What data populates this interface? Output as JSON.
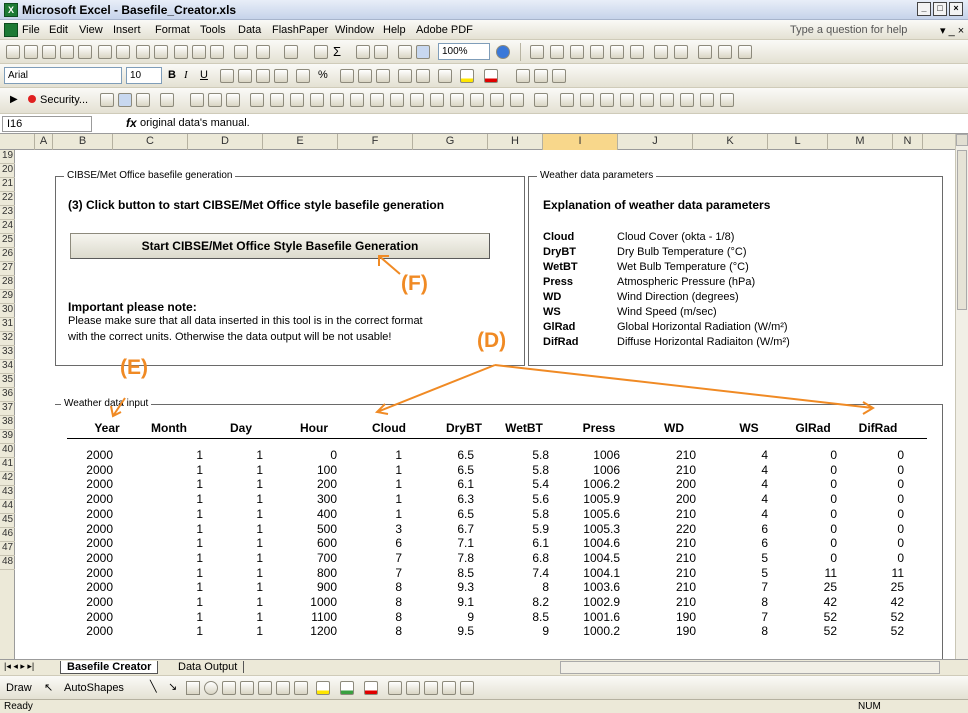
{
  "window": {
    "title": "Microsoft Excel - Basefile_Creator.xls",
    "min": "_",
    "max": "□",
    "close": "×"
  },
  "menu": {
    "items": [
      "File",
      "Edit",
      "View",
      "Insert",
      "Format",
      "Tools",
      "Data",
      "FlashPaper",
      "Window",
      "Help",
      "Adobe PDF"
    ],
    "help_placeholder": "Type a question for help"
  },
  "toolbar": {
    "zoom": "100%",
    "font": "Arial",
    "size": "10",
    "bold": "B",
    "italic": "I",
    "underline": "U",
    "security": "Security...",
    "percent": "%",
    "sigma": "Σ"
  },
  "formula": {
    "namebox": "I16",
    "fx": "fx",
    "content": "original data's manual."
  },
  "columns": [
    "A",
    "B",
    "C",
    "D",
    "E",
    "F",
    "G",
    "H",
    "I",
    "J",
    "K",
    "L",
    "M",
    "N"
  ],
  "rows": [
    "19",
    "20",
    "21",
    "22",
    "23",
    "24",
    "25",
    "26",
    "27",
    "28",
    "29",
    "30",
    "31",
    "32",
    "33",
    "34",
    "35",
    "36",
    "37",
    "38",
    "39",
    "40",
    "41",
    "42",
    "43",
    "44",
    "45",
    "46",
    "47",
    "48"
  ],
  "gen_group": {
    "label": "CIBSE/Met Office basefile generation",
    "step": "(3) Click button to start CIBSE/Met Office style basefile generation",
    "button": "Start CIBSE/Met Office Style Basefile Generation",
    "note_title": "Important please note:",
    "note_line1": "Please make sure that all data inserted in this tool is in the correct format",
    "note_line2": "with the correct units. Otherwise the data output will be not usable!"
  },
  "params_group": {
    "label": "Weather data parameters",
    "heading": "Explanation of weather data parameters",
    "items": [
      {
        "code": "Cloud",
        "desc": "Cloud Cover (okta - 1/8)"
      },
      {
        "code": "DryBT",
        "desc": "Dry Bulb Temperature (°C)"
      },
      {
        "code": "WetBT",
        "desc": "Wet Bulb Temperature (°C)"
      },
      {
        "code": "Press",
        "desc": "Atmospheric Pressure (hPa)"
      },
      {
        "code": "WD",
        "desc": "Wind Direction (degrees)"
      },
      {
        "code": "WS",
        "desc": "Wind Speed (m/sec)"
      },
      {
        "code": "GlRad",
        "desc": "Global Horizontal Radiation (W/m²)"
      },
      {
        "code": "DifRad",
        "desc": "Diffuse Horizontal Radiaiton (W/m²)"
      }
    ]
  },
  "annotations": {
    "D": "(D)",
    "E": "(E)",
    "F": "(F)"
  },
  "input_group": {
    "label": "Weather data input",
    "headers": [
      "Year",
      "Month",
      "Day",
      "Hour",
      "Cloud",
      "DryBT",
      "WetBT",
      "Press",
      "WD",
      "WS",
      "GlRad",
      "DifRad"
    ],
    "rows": [
      [
        "2000",
        "1",
        "1",
        "0",
        "1",
        "6.5",
        "5.8",
        "1006",
        "210",
        "4",
        "0",
        "0"
      ],
      [
        "2000",
        "1",
        "1",
        "100",
        "1",
        "6.5",
        "5.8",
        "1006",
        "210",
        "4",
        "0",
        "0"
      ],
      [
        "2000",
        "1",
        "1",
        "200",
        "1",
        "6.1",
        "5.4",
        "1006.2",
        "200",
        "4",
        "0",
        "0"
      ],
      [
        "2000",
        "1",
        "1",
        "300",
        "1",
        "6.3",
        "5.6",
        "1005.9",
        "200",
        "4",
        "0",
        "0"
      ],
      [
        "2000",
        "1",
        "1",
        "400",
        "1",
        "6.5",
        "5.8",
        "1005.6",
        "210",
        "4",
        "0",
        "0"
      ],
      [
        "2000",
        "1",
        "1",
        "500",
        "3",
        "6.7",
        "5.9",
        "1005.3",
        "220",
        "6",
        "0",
        "0"
      ],
      [
        "2000",
        "1",
        "1",
        "600",
        "6",
        "7.1",
        "6.1",
        "1004.6",
        "210",
        "6",
        "0",
        "0"
      ],
      [
        "2000",
        "1",
        "1",
        "700",
        "7",
        "7.8",
        "6.8",
        "1004.5",
        "210",
        "5",
        "0",
        "0"
      ],
      [
        "2000",
        "1",
        "1",
        "800",
        "7",
        "8.5",
        "7.4",
        "1004.1",
        "210",
        "5",
        "11",
        "11"
      ],
      [
        "2000",
        "1",
        "1",
        "900",
        "8",
        "9.3",
        "8",
        "1003.6",
        "210",
        "7",
        "25",
        "25"
      ],
      [
        "2000",
        "1",
        "1",
        "1000",
        "8",
        "9.1",
        "8.2",
        "1002.9",
        "210",
        "8",
        "42",
        "42"
      ],
      [
        "2000",
        "1",
        "1",
        "1100",
        "8",
        "9",
        "8.5",
        "1001.6",
        "190",
        "7",
        "52",
        "52"
      ],
      [
        "2000",
        "1",
        "1",
        "1200",
        "8",
        "9.5",
        "9",
        "1000.2",
        "190",
        "8",
        "52",
        "52"
      ]
    ]
  },
  "tabs": [
    "Basefile Creator",
    "Data Output"
  ],
  "drawbar": {
    "draw": "Draw",
    "autoshapes": "AutoShapes"
  },
  "status": {
    "left": "Ready",
    "num": "NUM"
  }
}
